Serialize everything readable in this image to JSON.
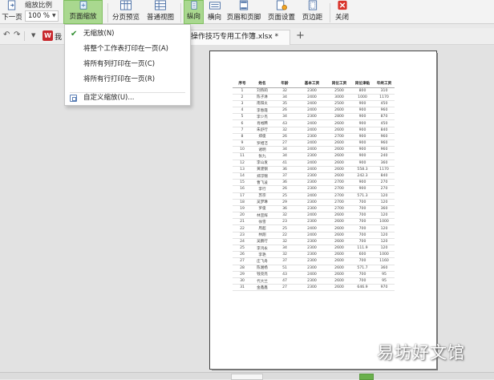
{
  "toolbar": {
    "zoom_label": "缩放比例",
    "zoom_value": "100 %",
    "next_page": "下一页",
    "page_zoom": "页面缩放",
    "page_preview": "分页预览",
    "normal_view": "普通视图",
    "portrait": "纵向",
    "landscape": "横向",
    "header_footer": "页眉和页脚",
    "page_setup": "页面设置",
    "page_margins": "页边距",
    "close": "关闭"
  },
  "tabbar": {
    "doc_tab": "用操作技巧专用工作簿.xlsx *",
    "plus": "+",
    "logo_letter": "W",
    "logo_text": "我"
  },
  "menu": {
    "items": [
      {
        "label": "无缩放(N)",
        "checked": true
      },
      {
        "label": "将整个工作表打印在一页(A)"
      },
      {
        "label": "将所有列打印在一页(C)"
      },
      {
        "label": "将所有行打印在一页(R)"
      },
      {
        "label": "自定义缩放(U)..."
      }
    ]
  },
  "table": {
    "headers": [
      "序号",
      "姓名",
      "年龄",
      "基本工资",
      "岗位工资",
      "岗位津贴",
      "年终工资"
    ],
    "rows": [
      [
        "1",
        "刘燕莉",
        "32",
        "2300",
        "2500",
        "800",
        "310"
      ],
      [
        "2",
        "陈子淋",
        "34",
        "2400",
        "3000",
        "1000",
        "1170"
      ],
      [
        "3",
        "南阳炎",
        "35",
        "2400",
        "2500",
        "900",
        "450"
      ],
      [
        "4",
        "李春霞",
        "26",
        "2400",
        "2600",
        "900",
        "960"
      ],
      [
        "5",
        "李少杰",
        "34",
        "2300",
        "2800",
        "900",
        "870"
      ],
      [
        "6",
        "肖裕腾",
        "43",
        "2400",
        "2600",
        "900",
        "450"
      ],
      [
        "7",
        "朱舒行",
        "32",
        "2400",
        "2600",
        "900",
        "840"
      ],
      [
        "8",
        "郑俊",
        "26",
        "2300",
        "2700",
        "900",
        "960"
      ],
      [
        "9",
        "罗相洁",
        "27",
        "2400",
        "2600",
        "900",
        "960"
      ],
      [
        "10",
        "诸明",
        "34",
        "2400",
        "2600",
        "900",
        "960"
      ],
      [
        "11",
        "张九",
        "34",
        "2300",
        "2600",
        "900",
        "240"
      ],
      [
        "12",
        "李山发",
        "41",
        "2400",
        "2600",
        "900",
        "360"
      ],
      [
        "13",
        "黄建钢",
        "36",
        "2400",
        "2600",
        "558.3",
        "1170"
      ],
      [
        "14",
        "郑浮锦",
        "37",
        "2300",
        "2600",
        "242.3",
        "840"
      ],
      [
        "15",
        "曹飞凌",
        "36",
        "2300",
        "2700",
        "900",
        "270"
      ],
      [
        "16",
        "李行",
        "26",
        "2300",
        "2700",
        "900",
        "270"
      ],
      [
        "17",
        "苏宗",
        "25",
        "2400",
        "2700",
        "571.3",
        "120"
      ],
      [
        "18",
        "吴梦琳",
        "29",
        "2300",
        "2700",
        "700",
        "120"
      ],
      [
        "19",
        "罗俊",
        "36",
        "2300",
        "2700",
        "700",
        "360"
      ],
      [
        "20",
        "林宣辉",
        "32",
        "2400",
        "2600",
        "700",
        "120"
      ],
      [
        "21",
        "徐雪",
        "23",
        "2300",
        "2600",
        "700",
        "1000"
      ],
      [
        "22",
        "周超",
        "25",
        "2400",
        "2600",
        "700",
        "120"
      ],
      [
        "23",
        "林翔",
        "22",
        "2400",
        "2600",
        "700",
        "120"
      ],
      [
        "24",
        "吴鹏行",
        "32",
        "2300",
        "2600",
        "700",
        "120"
      ],
      [
        "25",
        "李鸿永",
        "34",
        "2300",
        "2600",
        "111.9",
        "120"
      ],
      [
        "26",
        "李艳",
        "32",
        "2300",
        "2600",
        "600",
        "1000"
      ],
      [
        "27",
        "庄飞舟",
        "37",
        "2300",
        "2600",
        "700",
        "1160"
      ],
      [
        "28",
        "陈湘杨",
        "51",
        "2300",
        "2600",
        "571.7",
        "360"
      ],
      [
        "29",
        "钱亮亮",
        "43",
        "2400",
        "2600",
        "700",
        "95"
      ],
      [
        "30",
        "代大兰",
        "47",
        "2300",
        "2600",
        "700",
        "95"
      ],
      [
        "31",
        "金鑫鑫",
        "27",
        "2300",
        "2600",
        "646.9",
        "970"
      ]
    ]
  },
  "watermark": "易坊好文馆",
  "colors": {
    "selected_button": "#a9d88f",
    "check": "#2f8d2f",
    "close_icon": "#d9342b",
    "logo": "#c8282d"
  }
}
